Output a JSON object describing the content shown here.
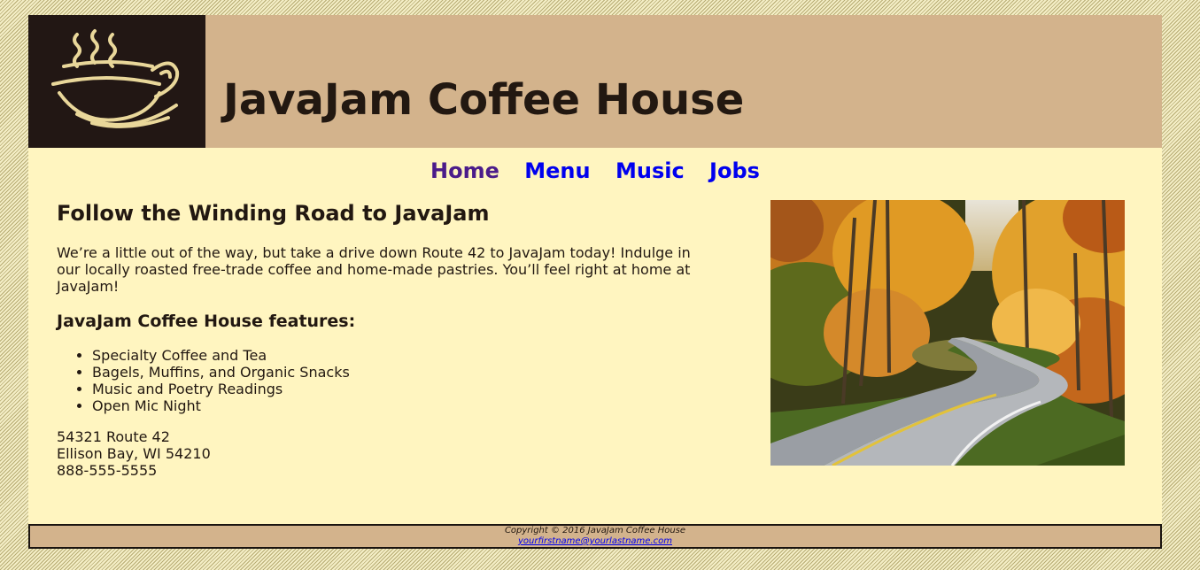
{
  "header": {
    "title": "JavaJam Coffee House",
    "logo_icon": "coffee-cup-logo-icon"
  },
  "nav": {
    "items": [
      {
        "label": "Home",
        "visited": true
      },
      {
        "label": "Menu",
        "visited": false
      },
      {
        "label": "Music",
        "visited": false
      },
      {
        "label": "Jobs",
        "visited": false
      }
    ]
  },
  "main": {
    "heading": "Follow the Winding Road to JavaJam",
    "intro": "We’re a little out of the way, but take a drive down Route 42 to JavaJam today! Indulge in our locally roasted free-trade coffee and home-made pastries. You’ll feel right at home at JavaJam!",
    "features_heading": "JavaJam Coffee House features:",
    "features": [
      "Specialty Coffee and Tea",
      "Bagels, Muffins, and Organic Snacks",
      "Music and Poetry Readings",
      "Open Mic Night"
    ],
    "address": {
      "street": "54321 Route 42",
      "city": "Ellison Bay, WI 54210",
      "phone": "888-555-5555"
    },
    "hero_image": "winding-road-autumn-photo"
  },
  "footer": {
    "copyright": "Copyright © 2016 JavaJam Coffee House",
    "email": "yourfirstname@yourlastname.com"
  },
  "colors": {
    "header_bg": "#d3b38c",
    "wrapper_bg": "#fff5c0",
    "logo_bg": "#221714",
    "text": "#221811",
    "link": "#0000ee",
    "visited_link": "#4b1c8a"
  }
}
